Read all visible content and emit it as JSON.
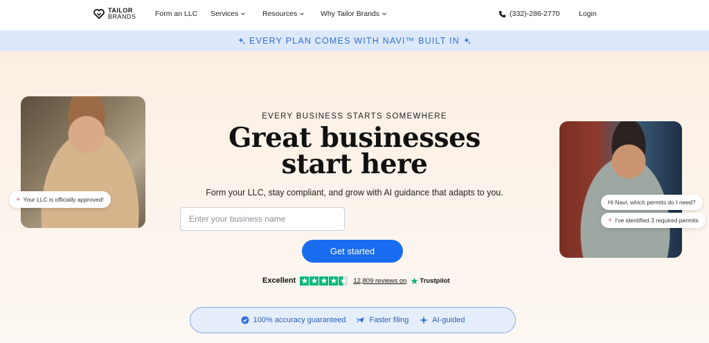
{
  "header": {
    "logo_line1": "TAILOR",
    "logo_line2": "BRANDS",
    "nav": [
      {
        "label": "Form an LLC"
      },
      {
        "label": "Services"
      },
      {
        "label": "Resources"
      },
      {
        "label": "Why Tailor Brands"
      }
    ],
    "phone": "(332)-286-2770",
    "login": "Login"
  },
  "banner": {
    "text": "EVERY PLAN COMES WITH NAVI™ BUILT IN"
  },
  "hero": {
    "eyebrow": "EVERY BUSINESS STARTS SOMEWHERE",
    "headline_line1": "Great businesses",
    "headline_line2": "start here",
    "subhead": "Form your LLC, stay compliant, and grow with AI guidance that adapts to you.",
    "input_placeholder": "Enter your business name",
    "cta_label": "Get started",
    "left_bubble": "Your LLC is officially approved!",
    "right_bubble1": "Hi Navi, which permits do I need?",
    "right_bubble2": "I've identified 3 required permits"
  },
  "trust": {
    "rating_label": "Excellent",
    "stars": 4.5,
    "reviews": "12,809 reviews on",
    "brand": "Trustpilot"
  },
  "features": [
    {
      "icon": "check-badge-icon",
      "label": "100% accuracy guaranteed"
    },
    {
      "icon": "fast-plane-icon",
      "label": "Faster filing"
    },
    {
      "icon": "sparkle-icon",
      "label": "AI-guided"
    }
  ],
  "colors": {
    "accent": "#1a6cf0",
    "banner_bg": "#dde9fb",
    "banner_text": "#2f6fd8",
    "trustpilot_green": "#00b67a"
  }
}
